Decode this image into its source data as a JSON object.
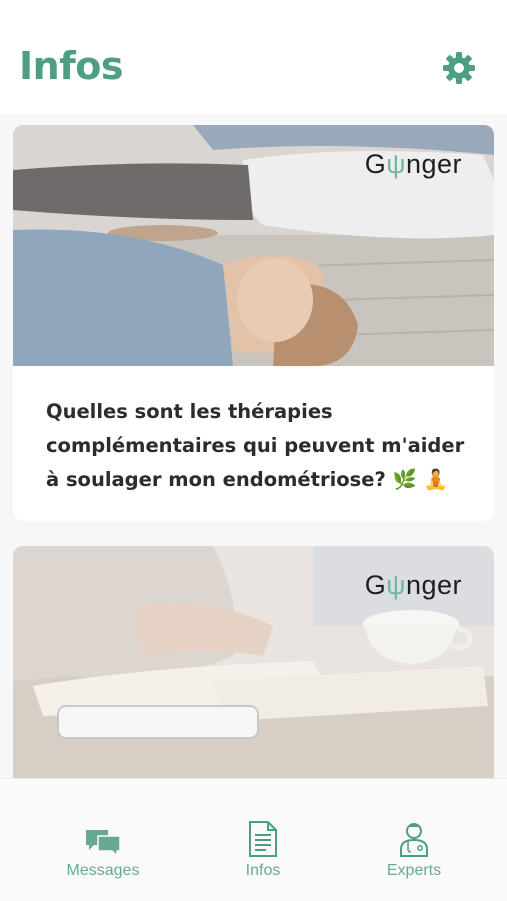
{
  "header": {
    "title": "Infos",
    "settings_icon": "gear-icon"
  },
  "feed": {
    "articles": [
      {
        "title": "Quelles sont les thérapies complémentaires qui peuvent m'aider à soulager mon endométriose?",
        "emoji": [
          "leaf-emoji",
          "woman-meditating-emoji"
        ],
        "image_description_icon": "yoga-relaxation-photo",
        "brand": "Gynger"
      },
      {
        "title": "",
        "image_description_icon": "notebook-desk-photo",
        "brand": "Gynger"
      }
    ]
  },
  "tabbar": {
    "items": [
      {
        "label": "Messages",
        "icon": "chat-bubbles-icon"
      },
      {
        "label": "Infos",
        "icon": "document-icon"
      },
      {
        "label": "Experts",
        "icon": "doctor-icon"
      }
    ]
  },
  "colors": {
    "accent": "#4e9e84",
    "tab_inactive": "#6aa896",
    "background": "#f7f7f7",
    "card": "#ffffff"
  }
}
